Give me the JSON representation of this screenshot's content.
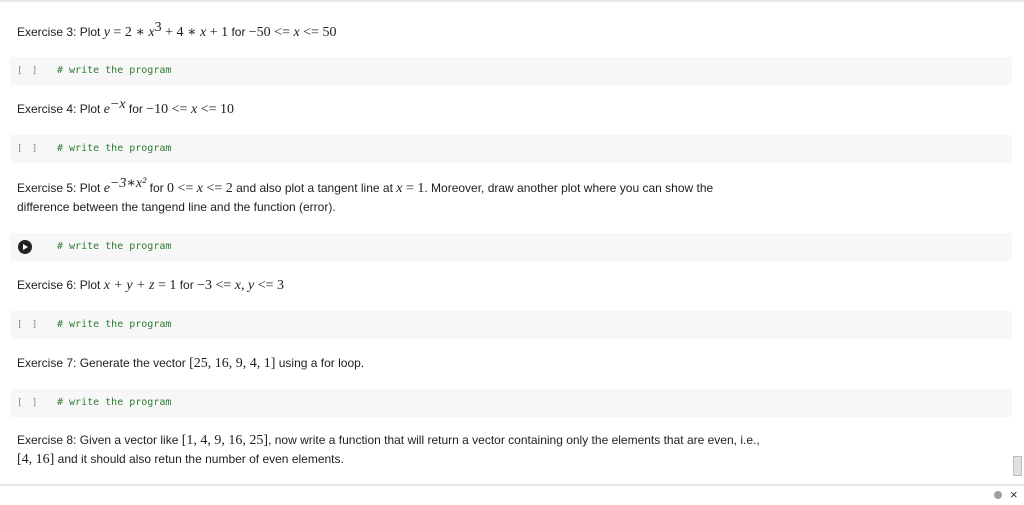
{
  "exercises": {
    "ex3": {
      "label": "Exercise 3: Plot ",
      "mathA": "y",
      "mathB": " = 2 ∗ ",
      "mathC": "x",
      "exp": "3",
      "mathD": " + 4 ∗ ",
      "mathE": "x",
      "mathF": " + 1",
      "for": " for ",
      "range": "−50 <= ",
      "rangeVar": "x",
      "rangeEnd": " <= 50"
    },
    "ex4": {
      "label": "Exercise 4: Plot ",
      "base": "e",
      "exp": "−x",
      "for": " for ",
      "range": "−10 <= ",
      "rangeVar": "x",
      "rangeEnd": " <= 10"
    },
    "ex5": {
      "label": "Exercise 5: Plot ",
      "base": "e",
      "exp": "−3∗x²",
      "for": " for ",
      "range": "0 <= ",
      "rangeVar": "x",
      "rangeEnd": " <= 2",
      "mid": " and also plot a tangent line at ",
      "atVar": "x",
      "atVal": " = 1",
      "rest": ". Moreover, draw another plot where you can show the",
      "line2": "difference between the tangend line and the function (error)."
    },
    "ex6": {
      "label": "Exercise 6: Plot ",
      "expr": "x + y + z",
      "eq": " = 1",
      "for": " for ",
      "range": "−3 <= ",
      "vars": "x, y",
      "rangeEnd": " <= 3"
    },
    "ex7": {
      "label": "Exercise 7: Generate the vector ",
      "vector": "[25, 16, 9, 4, 1]",
      "rest": " using a for loop."
    },
    "ex8": {
      "line1a": "Exercise 8: Given a vector like ",
      "vector1": "[1, 4, 9, 16, 25]",
      "line1b": ", now write a function that will return a vector containing only the elements that are even, i.e.,",
      "vector2": "[4, 16]",
      "line2": " and it should also retun the number of even elements."
    }
  },
  "cells": {
    "bracket": "[ ]",
    "code_text": "# write the program"
  },
  "footer": {
    "close": "×"
  }
}
